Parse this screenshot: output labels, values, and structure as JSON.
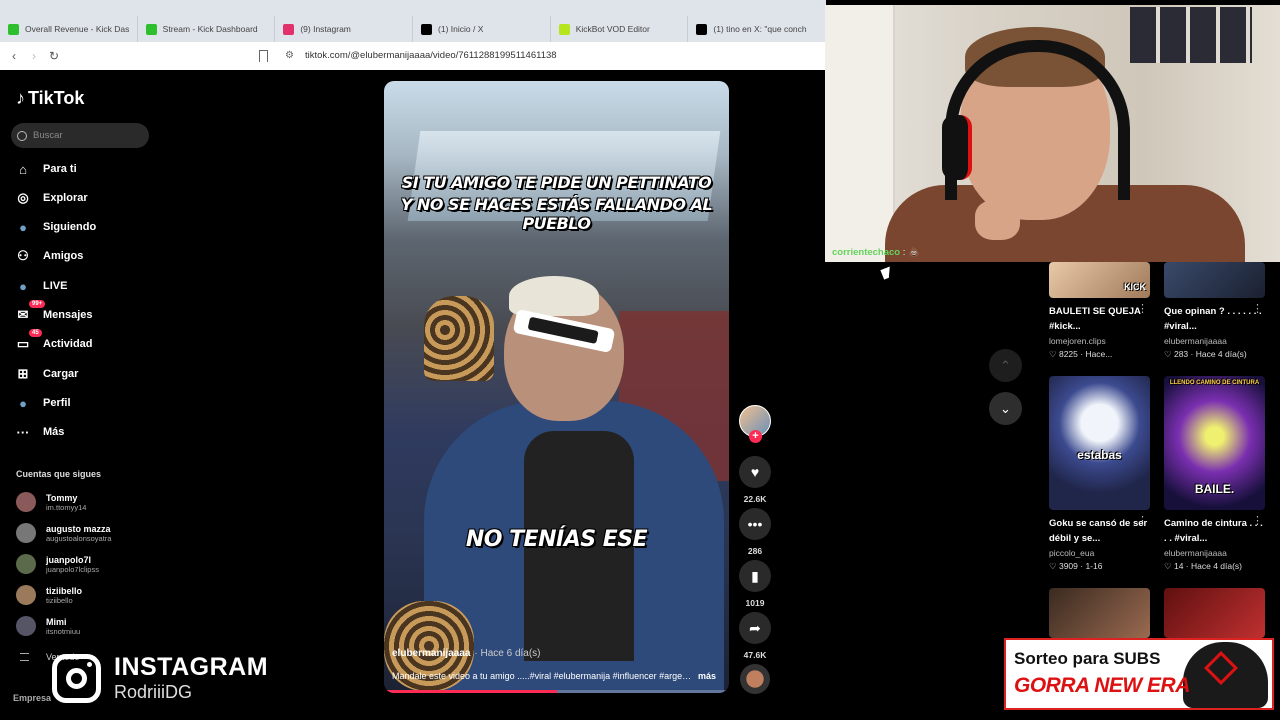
{
  "browser": {
    "tabs": [
      {
        "title": "Overall Revenue - Kick Dashbo",
        "icon": "kick-icon",
        "color": "#2dbf2d"
      },
      {
        "title": "Stream - Kick Dashboard",
        "icon": "kick-icon",
        "color": "#2dbf2d"
      },
      {
        "title": "(9) Instagram",
        "icon": "instagram-icon",
        "color": "#e1306c"
      },
      {
        "title": "(1) Inicio / X",
        "icon": "x-icon",
        "color": "#000000"
      },
      {
        "title": "KickBot VOD Editor",
        "icon": "kickbot-icon",
        "color": "#b5e61d"
      },
      {
        "title": "(1) tino en X: \"que conch",
        "icon": "x-icon",
        "color": "#000000"
      }
    ],
    "url": "tiktok.com/@elubermanijaaaa/video/7611288199511461138"
  },
  "tiktok": {
    "logo": "TikTok",
    "search_placeholder": "Buscar",
    "nav": [
      {
        "label": "Para ti",
        "icon": "home-icon"
      },
      {
        "label": "Explorar",
        "icon": "compass-icon"
      },
      {
        "label": "Siguiendo",
        "icon": "following-avatar-icon"
      },
      {
        "label": "Amigos",
        "icon": "friends-icon"
      },
      {
        "label": "LIVE",
        "icon": "live-avatar-icon"
      },
      {
        "label": "Mensajes",
        "icon": "messages-icon",
        "badge": "99+"
      },
      {
        "label": "Actividad",
        "icon": "activity-icon",
        "badge": "45"
      },
      {
        "label": "Cargar",
        "icon": "upload-icon"
      },
      {
        "label": "Perfil",
        "icon": "profile-avatar-icon"
      },
      {
        "label": "Más",
        "icon": "more-dots-icon"
      }
    ],
    "follows_title": "Cuentas que sigues",
    "follows": [
      {
        "name": "Tommy",
        "handle": "im.ttomyy14"
      },
      {
        "name": "augusto mazza",
        "handle": "augustoalonsoyatra"
      },
      {
        "name": "juanpolo7l",
        "handle": "juanpolo7lclipss"
      },
      {
        "name": "tiziibello",
        "handle": "tiziibello"
      },
      {
        "name": "Mimi",
        "handle": "itsnotmiuu"
      }
    ],
    "see_all": "Ver todo",
    "footer": "Empresa"
  },
  "video": {
    "caption_line1": "SI TU AMIGO TE PIDE UN PETTINATO",
    "caption_line2": "Y NO SE HACES ESTÁS FALLANDO AL PUEBLO",
    "caption_mid": "NO TENÍAS ESE",
    "username": "elubermanijaaaa",
    "time": "· Hace 6 día(s)",
    "description": "Mandale este video a tu amigo .....#viral #elubermanija #influencer #argentina",
    "more": "más",
    "progress": 0.5
  },
  "actions": {
    "likes": "22.6K",
    "comments": "286",
    "saves": "1019",
    "shares": "47.6K"
  },
  "overlay": {
    "ig_title": "INSTAGRAM",
    "ig_user": "RodriiiDG",
    "chat_name": "corrientechaco",
    "chat_sep": " : ",
    "chat_msg": "💩",
    "sorteo_line1": "Sorteo para SUBS",
    "sorteo_line2": "GORRA NEW ERA"
  },
  "related": [
    {
      "title": "BAULETI SE QUEJA #kick...",
      "author": "lomejoren.clips",
      "stats": "♡ 8225 · Hace...",
      "thumb_text": "KICK"
    },
    {
      "title": "Que opinan ? . . . . . . . #viral...",
      "author": "elubermanijaaaa",
      "stats": "♡ 283 · Hace 4 día(s)",
      "thumb_text": ""
    },
    {
      "title": "Goku se cansó de ser débil y se...",
      "author": "piccolo_eua",
      "stats": "♡ 3909 · 1-16",
      "thumb_text": "estabas"
    },
    {
      "title": "Camino de cintura . . . . . #viral...",
      "author": "elubermanijaaaa",
      "stats": "♡ 14 · Hace 4 día(s)",
      "thumb_text": "BAILE.",
      "thumb_top_text": "LLENDO CAMINO DE CINTURA"
    }
  ]
}
